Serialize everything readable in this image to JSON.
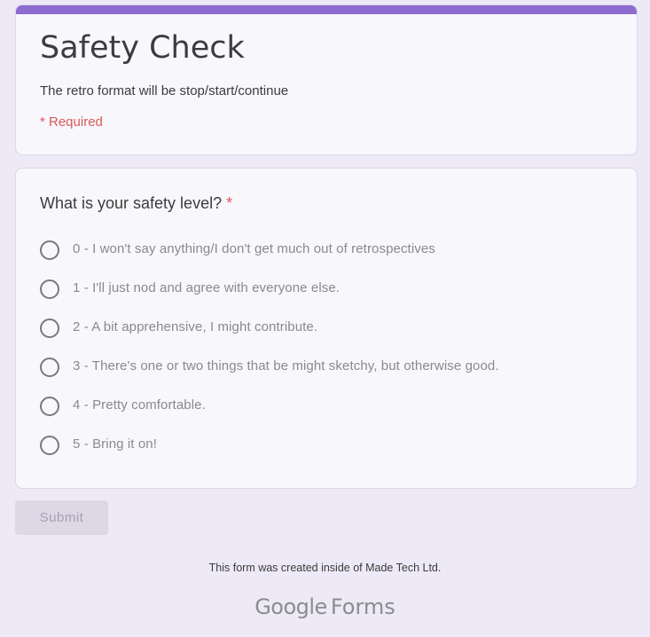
{
  "theme": {
    "accent_color": "#8e6ccf",
    "background_color": "#ede9f6",
    "required_color": "#d95a5a"
  },
  "form": {
    "title": "Safety Check",
    "description": "The retro format will be stop/start/continue",
    "required_note": "* Required"
  },
  "question": {
    "title": "What is your safety level?",
    "required_marker": "*",
    "options": [
      {
        "label": "0 - I won't say anything/I don't get much out of retrospectives"
      },
      {
        "label": "1 - I'll just nod and agree with everyone else."
      },
      {
        "label": "2 - A bit apprehensive, I might contribute."
      },
      {
        "label": "3 - There's one or two things that be might sketchy, but otherwise good."
      },
      {
        "label": "4 - Pretty comfortable."
      },
      {
        "label": "5 - Bring it on!"
      }
    ]
  },
  "submit": {
    "label": "Submit"
  },
  "footer": {
    "note": "This form was created inside of Made Tech Ltd.",
    "brand_google": "Google",
    "brand_forms": "Forms"
  }
}
